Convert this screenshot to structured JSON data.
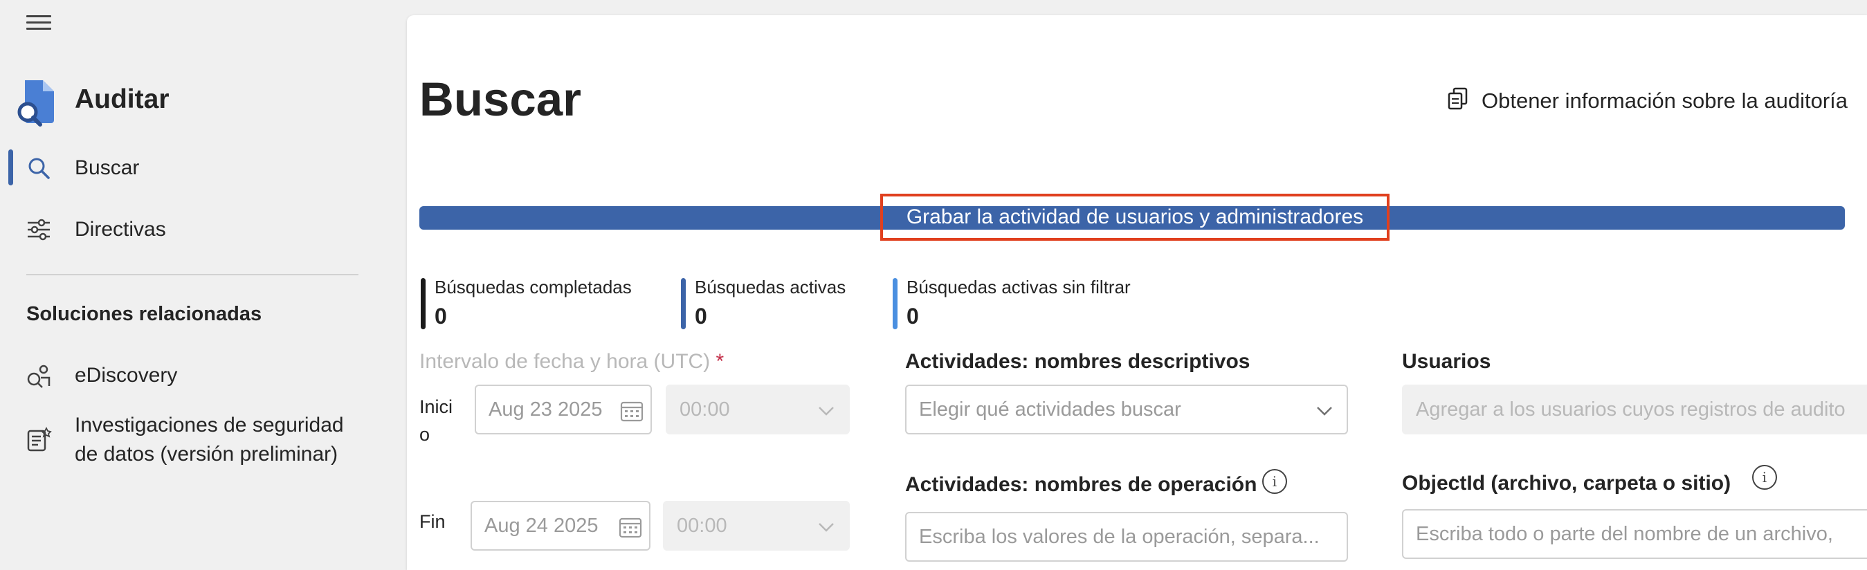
{
  "sidebar": {
    "app_title": "Auditar",
    "nav": [
      {
        "label": "Buscar",
        "icon": "search-icon",
        "active": true
      },
      {
        "label": "Directivas",
        "icon": "sliders-icon",
        "active": false
      }
    ],
    "section_heading": "Soluciones relacionadas",
    "related": [
      {
        "label": "eDiscovery",
        "icon": "ediscovery-icon"
      },
      {
        "label_line1": "Investigaciones de seguridad",
        "label_line2": "de datos (versión preliminar)",
        "icon": "investigation-icon"
      }
    ]
  },
  "main": {
    "title": "Buscar",
    "audit_info_label": "Obtener información sobre la auditoría",
    "banner_label": "Grabar la actividad de usuarios y administradores",
    "stats": [
      {
        "label": "Búsquedas completadas",
        "value": "0",
        "color": "#1a1a1a"
      },
      {
        "label": "Búsquedas activas",
        "value": "0",
        "color": "#3c64a8"
      },
      {
        "label": "Búsquedas activas sin filtrar",
        "value": "0",
        "color": "#4a8fe0"
      }
    ],
    "date_range": {
      "label": "Intervalo de fecha y hora (UTC)",
      "required_mark": "*",
      "start_label_line1": "Inici",
      "start_label_line2": "o",
      "start_date": "Aug 23 2025",
      "start_time": "00:00",
      "end_label": "Fin",
      "end_date": "Aug 24 2025",
      "end_time": "00:00"
    },
    "activities_friendly": {
      "label": "Actividades: nombres descriptivos",
      "placeholder": "Elegir qué actividades buscar"
    },
    "activities_operation": {
      "label": "Actividades: nombres de operación",
      "placeholder": "Escriba los valores de la operación, separa..."
    },
    "users": {
      "label": "Usuarios",
      "placeholder": "Agregar a los usuarios cuyos registros de audito"
    },
    "object_id": {
      "label": "ObjectId (archivo, carpeta o sitio)",
      "placeholder": "Escriba todo o parte del nombre de un archivo,"
    }
  },
  "colors": {
    "accent": "#3c64a8",
    "highlight_border": "#e0401e"
  }
}
